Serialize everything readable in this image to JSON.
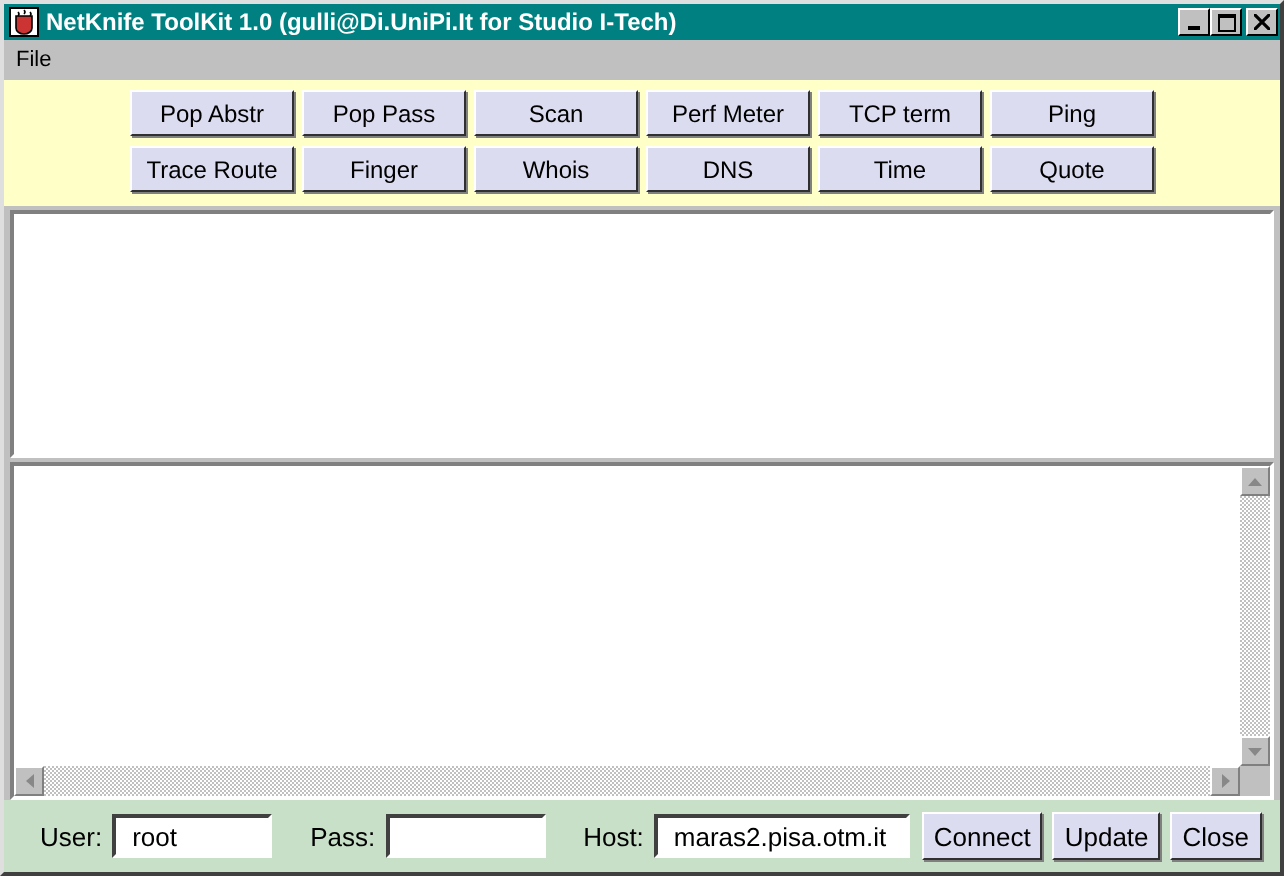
{
  "window": {
    "title": "NetKnife ToolKit 1.0 (gulli@Di.UniPi.It for Studio I-Tech)"
  },
  "menu": [
    "File"
  ],
  "tool_buttons": [
    [
      "Pop Abstr",
      "Pop Pass",
      "Scan",
      "Perf Meter",
      "TCP term",
      "Ping"
    ],
    [
      "Trace Route",
      "Finger",
      "Whois",
      "DNS",
      "Time",
      "Quote"
    ]
  ],
  "footer": {
    "user": {
      "label": "User:",
      "value": "root"
    },
    "pass": {
      "label": "Pass:"
    },
    "host": {
      "label": "Host:",
      "value": "maras2.pisa.otm.it"
    },
    "buttons": [
      "Connect",
      "Update",
      "Close"
    ]
  }
}
